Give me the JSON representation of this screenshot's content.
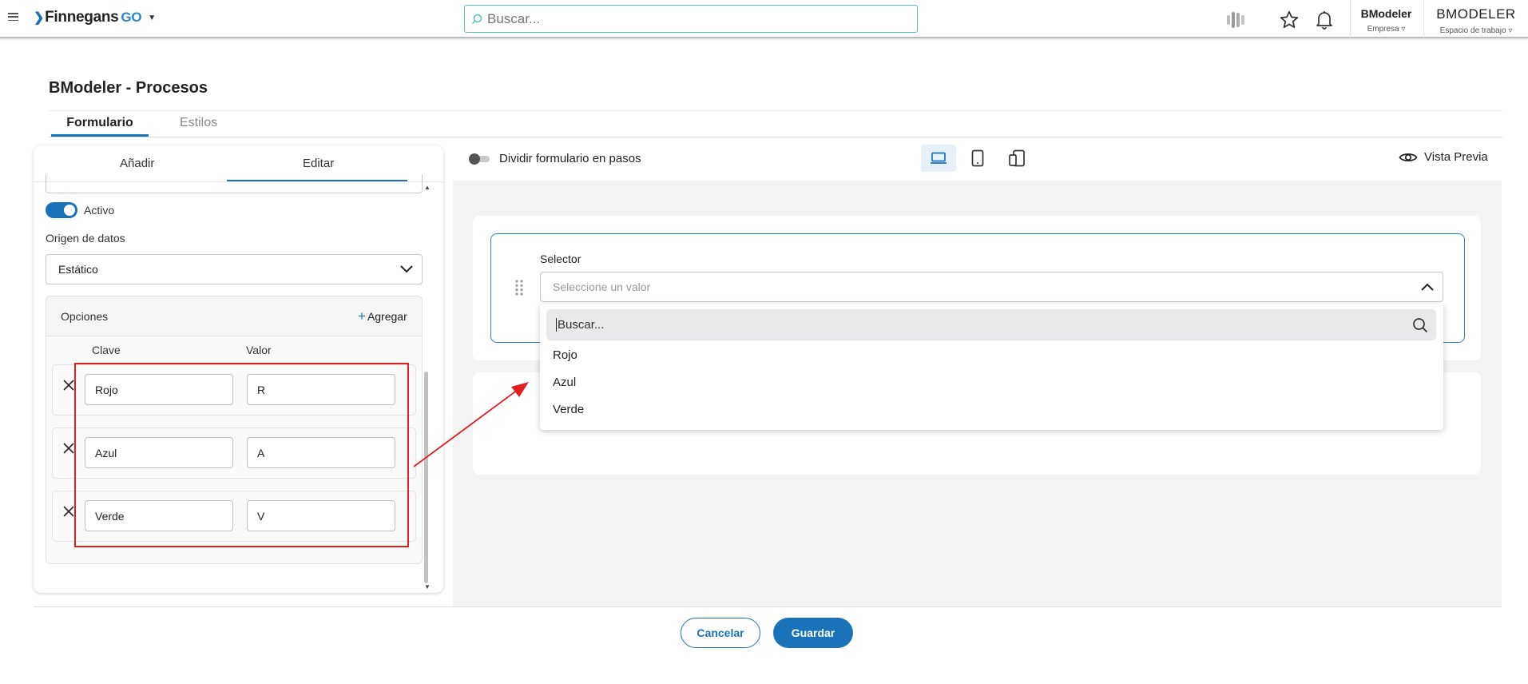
{
  "header": {
    "logo_text": "Finnegans",
    "logo_suffix": "GO",
    "search_placeholder": "Buscar...",
    "company_name": "BModeler",
    "company_label": "Empresa ▿",
    "workspace_name": "BMODELER",
    "workspace_label": "Espacio de trabajo ▿"
  },
  "page": {
    "title": "BModeler - Procesos",
    "tabs": [
      {
        "label": "Formulario",
        "active": true
      },
      {
        "label": "Estilos",
        "active": false
      }
    ]
  },
  "editor": {
    "tabs": [
      {
        "label": "Añadir",
        "active": false
      },
      {
        "label": "Editar",
        "active": true
      }
    ],
    "active_label": "Activo",
    "active_on": true,
    "data_origin_label": "Origen de datos",
    "data_origin_value": "Estático",
    "options_title": "Opciones",
    "add_label": "Agregar",
    "col_key": "Clave",
    "col_value": "Valor",
    "options": [
      {
        "key": "Rojo",
        "value": "R"
      },
      {
        "key": "Azul",
        "value": "A"
      },
      {
        "key": "Verde",
        "value": "V"
      }
    ]
  },
  "canvas": {
    "split_steps_label": "Dividir formulario en pasos",
    "split_steps_on": false,
    "preview_label": "Vista Previa",
    "selector_label": "Selector",
    "selector_placeholder": "Seleccione un valor",
    "dropdown_search_placeholder": "Buscar...",
    "dropdown_items": [
      "Rojo",
      "Azul",
      "Verde"
    ]
  },
  "footer": {
    "cancel_label": "Cancelar",
    "save_label": "Guardar"
  },
  "colors": {
    "accent": "#1a73b8",
    "annotation": "#e02020"
  }
}
